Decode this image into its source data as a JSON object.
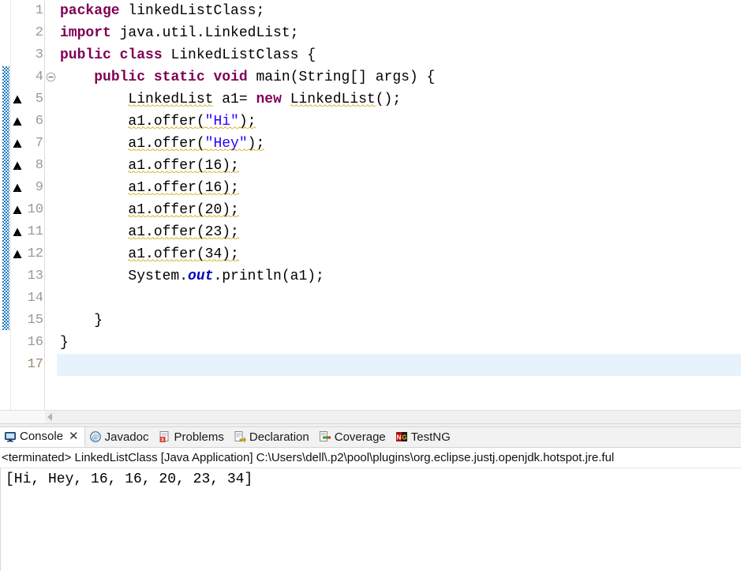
{
  "editor": {
    "font_size_px": 18,
    "line_height_px": 28,
    "caret_line": 17,
    "first_visible_line": 1,
    "total_visible_lines": 17,
    "colors": {
      "keyword": "#7F0055",
      "string": "#2A00FF",
      "static_field": "#0000C0",
      "plain_text": "#000000",
      "line_number": "#999999",
      "caret_line_bg": "#E8F2FC",
      "warning_squiggle": "#D4AF20",
      "diff_marker": "#1B7BC4",
      "editor_bg": "#FFFFFF"
    },
    "line_numbers": [
      1,
      2,
      3,
      4,
      5,
      6,
      7,
      8,
      9,
      10,
      11,
      12,
      13,
      14,
      15,
      16,
      17
    ],
    "fold_marker_line": 4,
    "warning_marker_lines": [
      5,
      6,
      7,
      8,
      9,
      10,
      11,
      12
    ],
    "diff_marker_lines": [
      4,
      5,
      6,
      7,
      8,
      9,
      10,
      11,
      12,
      13,
      14,
      15
    ],
    "lines": [
      {
        "n": 1,
        "tokens": [
          {
            "t": "package",
            "c": "kw"
          },
          {
            "t": " linkedListClass;",
            "c": "plain"
          }
        ]
      },
      {
        "n": 2,
        "tokens": [
          {
            "t": "import",
            "c": "kw"
          },
          {
            "t": " java.util.LinkedList;",
            "c": "plain"
          }
        ]
      },
      {
        "n": 3,
        "tokens": [
          {
            "t": "public",
            "c": "kw"
          },
          {
            "t": " ",
            "c": "plain"
          },
          {
            "t": "class",
            "c": "kw"
          },
          {
            "t": " LinkedListClass {",
            "c": "plain"
          }
        ]
      },
      {
        "n": 4,
        "tokens": [
          {
            "t": "    ",
            "c": "plain"
          },
          {
            "t": "public",
            "c": "kw"
          },
          {
            "t": " ",
            "c": "plain"
          },
          {
            "t": "static",
            "c": "kw"
          },
          {
            "t": " ",
            "c": "plain"
          },
          {
            "t": "void",
            "c": "kw"
          },
          {
            "t": " main(String[] args) {",
            "c": "plain"
          }
        ]
      },
      {
        "n": 5,
        "tokens": [
          {
            "t": "        ",
            "c": "plain"
          },
          {
            "t": "LinkedList",
            "c": "plain",
            "warn": true
          },
          {
            "t": " a1= ",
            "c": "plain"
          },
          {
            "t": "new",
            "c": "kw"
          },
          {
            "t": " ",
            "c": "plain"
          },
          {
            "t": "LinkedList",
            "c": "plain",
            "warn": true
          },
          {
            "t": "();",
            "c": "plain"
          }
        ]
      },
      {
        "n": 6,
        "tokens": [
          {
            "t": "        ",
            "c": "plain"
          },
          {
            "t": "a1.offer(",
            "c": "plain",
            "warn": true
          },
          {
            "t": "\"Hi\"",
            "c": "str",
            "warn": true
          },
          {
            "t": ");",
            "c": "plain",
            "warn": true
          }
        ]
      },
      {
        "n": 7,
        "tokens": [
          {
            "t": "        ",
            "c": "plain"
          },
          {
            "t": "a1.offer(",
            "c": "plain",
            "warn": true
          },
          {
            "t": "\"Hey\"",
            "c": "str",
            "warn": true
          },
          {
            "t": ");",
            "c": "plain",
            "warn": true
          }
        ]
      },
      {
        "n": 8,
        "tokens": [
          {
            "t": "        ",
            "c": "plain"
          },
          {
            "t": "a1.offer(16);",
            "c": "plain",
            "warn": true
          }
        ]
      },
      {
        "n": 9,
        "tokens": [
          {
            "t": "        ",
            "c": "plain"
          },
          {
            "t": "a1.offer(16);",
            "c": "plain",
            "warn": true
          }
        ]
      },
      {
        "n": 10,
        "tokens": [
          {
            "t": "        ",
            "c": "plain"
          },
          {
            "t": "a1.offer(20);",
            "c": "plain",
            "warn": true
          }
        ]
      },
      {
        "n": 11,
        "tokens": [
          {
            "t": "        ",
            "c": "plain"
          },
          {
            "t": "a1.offer(23);",
            "c": "plain",
            "warn": true
          }
        ]
      },
      {
        "n": 12,
        "tokens": [
          {
            "t": "        ",
            "c": "plain"
          },
          {
            "t": "a1.offer(34);",
            "c": "plain",
            "warn": true
          }
        ]
      },
      {
        "n": 13,
        "tokens": [
          {
            "t": "        System.",
            "c": "plain"
          },
          {
            "t": "out",
            "c": "sfld"
          },
          {
            "t": ".println(a1);",
            "c": "plain"
          }
        ]
      },
      {
        "n": 14,
        "tokens": [
          {
            "t": "",
            "c": "plain"
          }
        ]
      },
      {
        "n": 15,
        "tokens": [
          {
            "t": "    }",
            "c": "plain"
          }
        ]
      },
      {
        "n": 16,
        "tokens": [
          {
            "t": "}",
            "c": "plain"
          }
        ]
      },
      {
        "n": 17,
        "tokens": [
          {
            "t": "",
            "c": "plain"
          }
        ]
      }
    ]
  },
  "editor_scrollbar": {
    "orientation": "horizontal",
    "left_arrow_icon": "triangle-left-icon"
  },
  "bottom_view": {
    "tabs": [
      {
        "label": "Console",
        "icon": "console-icon",
        "active": true,
        "closable": true,
        "close_label": "✕"
      },
      {
        "label": "Javadoc",
        "icon": "javadoc-icon",
        "active": false,
        "closable": false
      },
      {
        "label": "Problems",
        "icon": "problems-icon",
        "active": false,
        "closable": false
      },
      {
        "label": "Declaration",
        "icon": "declaration-icon",
        "active": false,
        "closable": false
      },
      {
        "label": "Coverage",
        "icon": "coverage-icon",
        "active": false,
        "closable": false
      },
      {
        "label": "TestNG",
        "icon": "testng-icon",
        "active": false,
        "closable": false
      }
    ],
    "launch_line": "<terminated> LinkedListClass [Java Application] C:\\Users\\dell\\.p2\\pool\\plugins\\org.eclipse.justj.openjdk.hotspot.jre.ful",
    "console_output": [
      "[Hi, Hey, 16, 16, 20, 23, 34]"
    ]
  }
}
